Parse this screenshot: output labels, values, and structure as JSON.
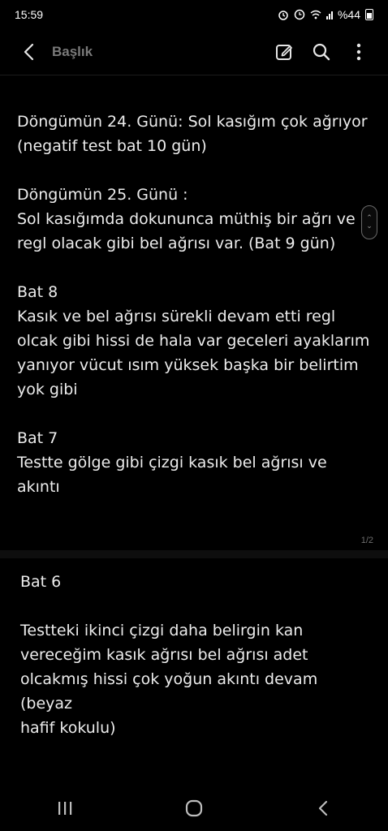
{
  "status_bar": {
    "time": "15:59",
    "battery_text": "%44"
  },
  "app_bar": {
    "title": "Başlık",
    "icons": [
      "back-icon",
      "edit-icon",
      "search-icon",
      "more-vert-icon"
    ]
  },
  "page1": {
    "text": "Döngümün 24. Günü: Sol kasığım çok ağrıyor\n(negatif test bat 10 gün)\n\nDöngümün 25. Günü :\nSol kasığımda dokununca müthiş bir ağrı ve\nregl olacak gibi bel ağrısı var. (Bat 9 gün)\n\nBat 8\nKasık ve bel ağrısı sürekli devam etti regl\nolcak gibi hissi de hala var geceleri ayaklarım\nyanıyor vücut ısım yüksek başka bir belirtim\nyok gibi\n\nBat 7\nTestte gölge gibi çizgi kasık bel ağrısı ve\nakıntı",
    "page_indicator": "1/2"
  },
  "page2": {
    "text": "Bat 6\n\nTestteki ikinci çizgi daha belirgin kan\nvereceğim kasık ağrısı bel ağrısı adet\nolcakmış hissi çok yoğun akıntı devam (beyaz\nhafif kokulu)"
  },
  "nav_bar": {
    "icons": [
      "recent-apps-icon",
      "home-icon",
      "back-nav-icon"
    ]
  }
}
